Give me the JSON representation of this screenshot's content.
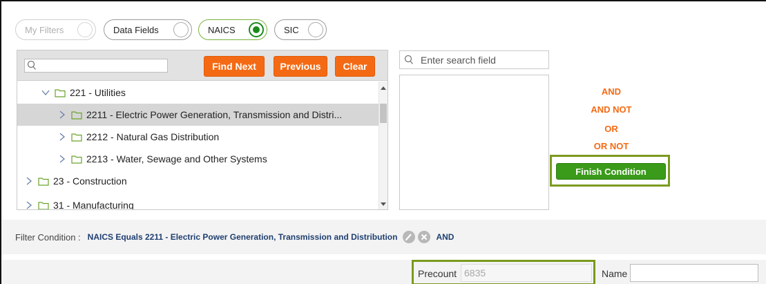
{
  "filter_toggles": [
    {
      "label": "My Filters",
      "state": "disabled"
    },
    {
      "label": "Data Fields",
      "state": "off"
    },
    {
      "label": "NAICS",
      "state": "on"
    },
    {
      "label": "SIC",
      "state": "off"
    }
  ],
  "tree_toolbar": {
    "search_value": "",
    "find_next_label": "Find Next",
    "previous_label": "Previous",
    "clear_label": "Clear"
  },
  "tree": {
    "rows": [
      {
        "label": "221 - Utilities",
        "expanded": true,
        "selected": false
      },
      {
        "label": "2211 - Electric Power Generation, Transmission and Distri...",
        "expanded": false,
        "selected": true
      },
      {
        "label": "2212 - Natural Gas Distribution",
        "expanded": false,
        "selected": false
      },
      {
        "label": "2213 - Water, Sewage and Other Systems",
        "expanded": false,
        "selected": false
      },
      {
        "label": "23 - Construction",
        "expanded": false,
        "selected": false
      },
      {
        "label": "31 - Manufacturing",
        "expanded": false,
        "selected": false
      }
    ]
  },
  "field_search": {
    "placeholder": "Enter search field"
  },
  "operators": {
    "and": "AND",
    "and_not": "AND NOT",
    "or": "OR",
    "or_not": "OR NOT",
    "finish": "Finish Condition"
  },
  "condition": {
    "label": "Filter Condition :",
    "text": "NAICS Equals 2211 - Electric Power Generation, Transmission and Distribution",
    "joiner": "AND"
  },
  "bottom": {
    "precount_label": "Precount",
    "precount_value": "6835",
    "name_label": "Name",
    "name_value": ""
  },
  "colors": {
    "accent_orange": "#f46a14",
    "accent_green": "#3a9a1a",
    "highlight_outline": "#7a9a1e",
    "condition_text": "#1f3f70"
  }
}
